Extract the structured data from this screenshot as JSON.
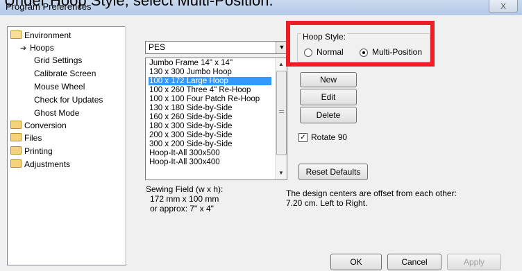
{
  "caption": "Under Hoop Style, select Multi-Position.",
  "window": {
    "title": "Program Preferences",
    "close_label": "X"
  },
  "tree": [
    {
      "label": "Environment",
      "icon": "folder-open-icon"
    },
    {
      "label": "Hoops",
      "icon": "arrow-right-icon"
    },
    {
      "label": "Grid Settings"
    },
    {
      "label": "Calibrate Screen"
    },
    {
      "label": "Mouse Wheel"
    },
    {
      "label": "Check for Updates"
    },
    {
      "label": "Ghost Mode"
    },
    {
      "label": "Conversion",
      "icon": "folder-icon"
    },
    {
      "label": "Files",
      "icon": "folder-icon"
    },
    {
      "label": "Printing",
      "icon": "folder-icon"
    },
    {
      "label": "Adjustments",
      "icon": "folder-icon"
    }
  ],
  "format_combo": {
    "value": "PES"
  },
  "hoop_list": {
    "items": [
      "Jumbo Frame 14\" x 14\"",
      "130 x 300 Jumbo Hoop",
      "100 x 172 Large Hoop",
      "100 x 260 Three 4\" Re-Hoop",
      "100 x 100 Four Patch Re-Hoop",
      "130 x 180 Side-by-Side",
      "160 x 260 Side-by-Side",
      "180 x 300 Side-by-Side",
      "200 x 300 Side-by-Side",
      "300 x 200 Side-by-Side",
      "Hoop-It-All 300x500",
      "Hoop-It-All 300x400"
    ],
    "selected_index": 2
  },
  "sewing_field": {
    "label": "Sewing Field (w x h):",
    "size": "172 mm x 100 mm",
    "approx": "or approx: 7\" x 4\""
  },
  "hoop_style": {
    "legend": "Hoop Style:",
    "options": [
      "Normal",
      "Multi-Position"
    ],
    "selected": "Multi-Position"
  },
  "buttons": {
    "new": "New",
    "edit": "Edit",
    "delete": "Delete",
    "reset": "Reset Defaults",
    "ok": "OK",
    "cancel": "Cancel",
    "apply": "Apply"
  },
  "rotate": {
    "label": "Rotate 90",
    "checked": true
  },
  "info": {
    "line1": "The design centers are offset from each other:",
    "line2": "7.20 cm. Left to Right."
  },
  "colors": {
    "highlight_box": "#ee1c25",
    "selection": "#3399ff"
  }
}
